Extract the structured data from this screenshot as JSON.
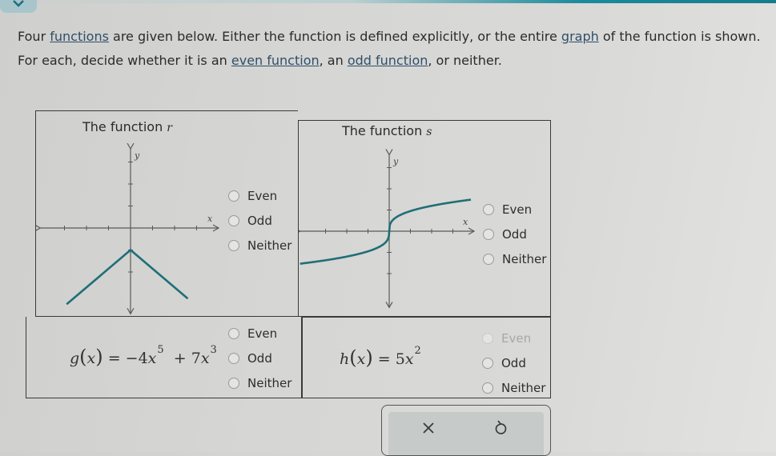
{
  "header": {
    "line1": {
      "pre": "Four ",
      "link1": "functions",
      "mid": " are given below. Either the function is defined explicitly, or the entire ",
      "link2": "graph",
      "post": " of the function is shown."
    },
    "line2": {
      "pre": "For each, decide whether it is an ",
      "link1": "even function",
      "mid": ", an ",
      "link2": "odd function",
      "post": ", or neither."
    }
  },
  "theme": {
    "curve_color": "#1f6f77",
    "axis_color": "#5a5a5a",
    "accent": "#1a8a9c"
  },
  "problems": [
    {
      "id": "r",
      "title_prefix": "The function",
      "var": "r",
      "type": "graph",
      "graph_description": "V-shaped graph opening downward with vertex at (0,-1)",
      "axis_labels": {
        "x": "x",
        "y": "y"
      },
      "options": [
        "Even",
        "Odd",
        "Neither"
      ]
    },
    {
      "id": "s",
      "title_prefix": "The function",
      "var": "s",
      "type": "graph",
      "graph_description": "Cube-root-shaped curve passing through the origin",
      "axis_labels": {
        "x": "x",
        "y": "y"
      },
      "options": [
        "Even",
        "Odd",
        "Neither"
      ]
    },
    {
      "id": "g",
      "type": "formula",
      "fname": "g",
      "arg": "x",
      "eq": "=",
      "terms": [
        {
          "coef": "−4",
          "var": "x",
          "exp": "5"
        },
        {
          "op": "+",
          "coef": "7",
          "var": "x",
          "exp": "3"
        }
      ],
      "options": [
        "Even",
        "Odd",
        "Neither"
      ]
    },
    {
      "id": "h",
      "type": "formula",
      "fname": "h",
      "arg": "x",
      "eq": "=",
      "terms": [
        {
          "coef": "5",
          "var": "x",
          "exp": "2"
        }
      ],
      "options": [
        "Even",
        "Odd",
        "Neither"
      ]
    }
  ],
  "actions": {
    "clear": "clear-icon",
    "undo": "undo-icon"
  }
}
